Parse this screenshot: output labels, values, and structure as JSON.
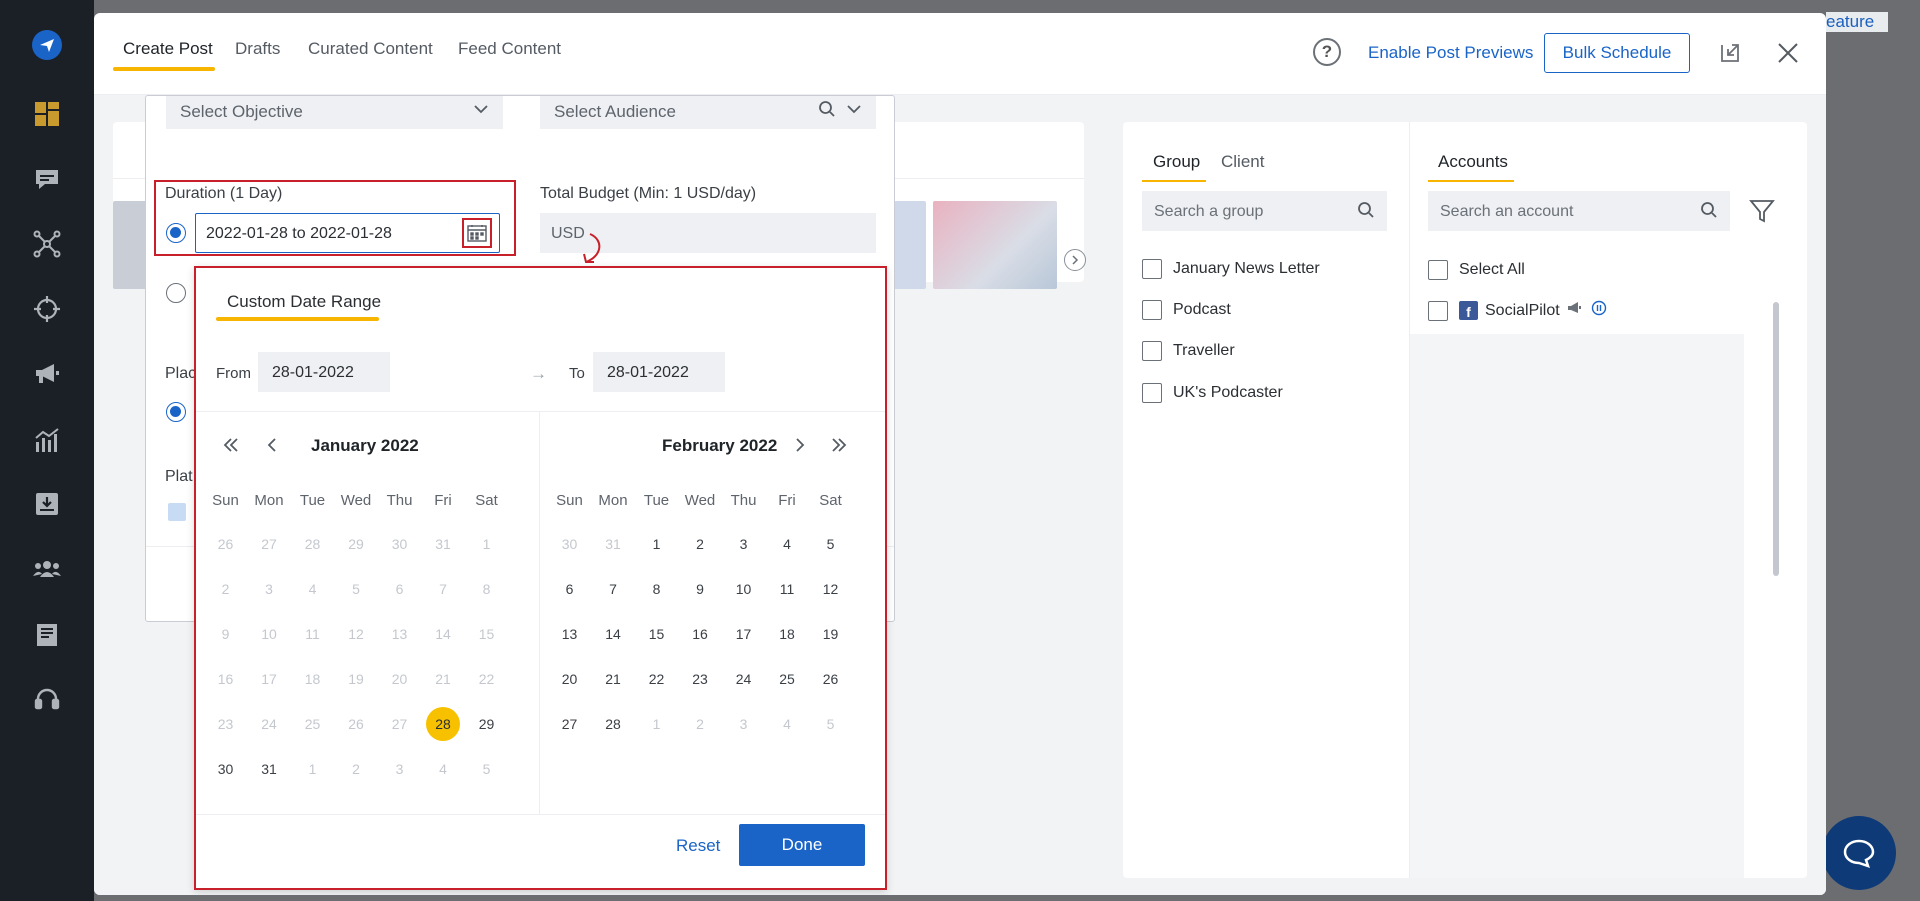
{
  "header": {
    "tabs": [
      {
        "label": "Create Post"
      },
      {
        "label": "Drafts"
      },
      {
        "label": "Curated Content"
      },
      {
        "label": "Feed Content"
      }
    ],
    "help_symbol": "?",
    "enable_previews": "Enable Post Previews",
    "bulk_schedule": "Bulk Schedule"
  },
  "background": {
    "topright_text": "eature"
  },
  "ad_form": {
    "objective_placeholder": "Select Objective",
    "audience_placeholder": "Select Audience",
    "duration_label": "Duration (1 Day)",
    "duration_value": "2022-01-28 to 2022-01-28",
    "budget_label": "Total Budget (Min: 1 USD/day)",
    "currency": "USD",
    "partial_label_1": "Plac",
    "partial_label_2": "Plat"
  },
  "date_picker": {
    "tab": "Custom Date Range",
    "from_label": "From",
    "from_value": "28-01-2022",
    "to_label": "To",
    "to_value": "28-01-2022",
    "arrow": "→",
    "weekdays": [
      "Sun",
      "Mon",
      "Tue",
      "Wed",
      "Thu",
      "Fri",
      "Sat"
    ],
    "left_month": "January 2022",
    "right_month": "February 2022",
    "left_days": [
      [
        "26",
        "27",
        "28",
        "29",
        "30",
        "31",
        "1"
      ],
      [
        "2",
        "3",
        "4",
        "5",
        "6",
        "7",
        "8"
      ],
      [
        "9",
        "10",
        "11",
        "12",
        "13",
        "14",
        "15"
      ],
      [
        "16",
        "17",
        "18",
        "19",
        "20",
        "21",
        "22"
      ],
      [
        "23",
        "24",
        "25",
        "26",
        "27",
        "28",
        "29"
      ],
      [
        "30",
        "31",
        "1",
        "2",
        "3",
        "4",
        "5"
      ]
    ],
    "right_days": [
      [
        "30",
        "31",
        "1",
        "2",
        "3",
        "4",
        "5"
      ],
      [
        "6",
        "7",
        "8",
        "9",
        "10",
        "11",
        "12"
      ],
      [
        "13",
        "14",
        "15",
        "16",
        "17",
        "18",
        "19"
      ],
      [
        "20",
        "21",
        "22",
        "23",
        "24",
        "25",
        "26"
      ],
      [
        "27",
        "28",
        "1",
        "2",
        "3",
        "4",
        "5"
      ]
    ],
    "reset": "Reset",
    "done": "Done"
  },
  "right_panel": {
    "group_tab": "Group",
    "client_tab": "Client",
    "accounts_tab": "Accounts",
    "group_search_placeholder": "Search a group",
    "account_search_placeholder": "Search an account",
    "groups": [
      "January News Letter",
      "Podcast",
      "Traveller",
      "UK's Podcaster"
    ],
    "select_all": "Select All",
    "account_name": "SocialPilot",
    "fb_letter": "f"
  },
  "colors": {
    "accent_blue": "#1a64c8",
    "accent_yellow": "#f7b500",
    "highlight_red": "#c8202a",
    "sidebar_bg": "#1b1f26"
  }
}
